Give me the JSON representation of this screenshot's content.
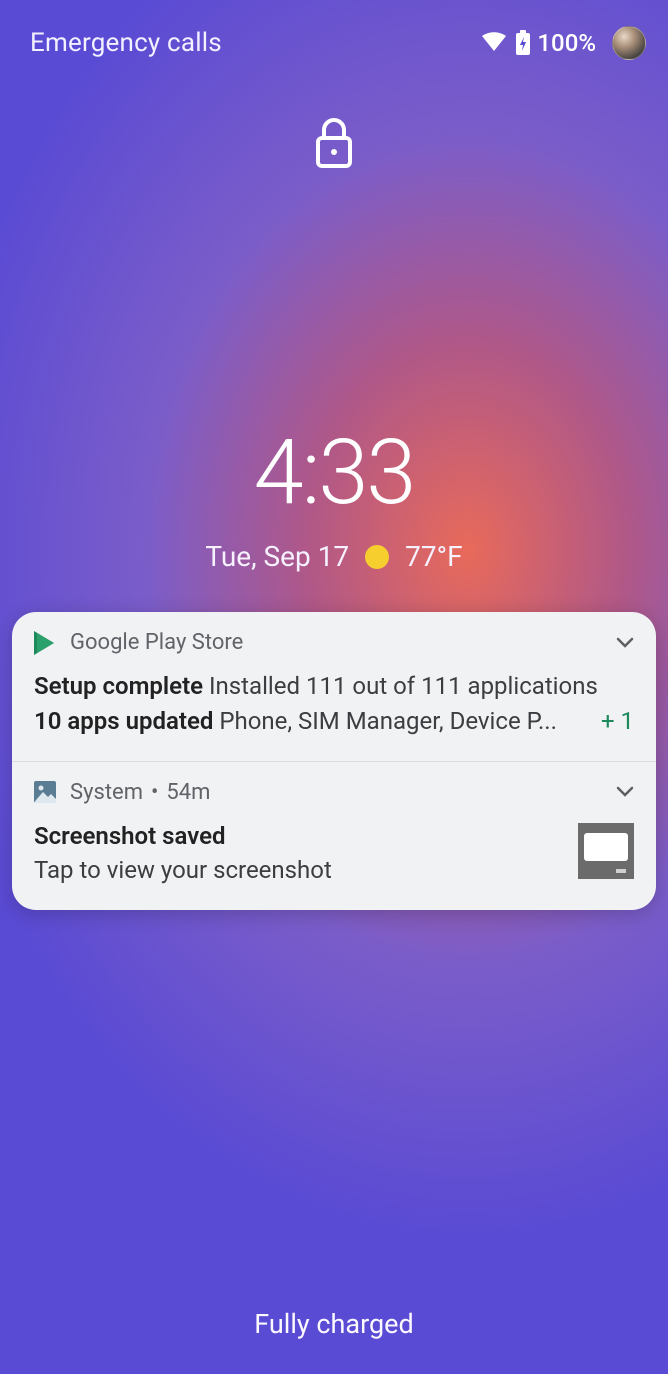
{
  "status": {
    "carrier_text": "Emergency calls",
    "battery_pct": "100%"
  },
  "clock": {
    "time": "4:33",
    "date": "Tue, Sep 17",
    "temp": "77°F"
  },
  "notifications": [
    {
      "app": "Google Play Store",
      "time": "",
      "line1_bold": "Setup complete",
      "line1_rest": " Installed 111 out of 111 applications",
      "line2_bold": "10 apps updated",
      "line2_rest": " Phone, SIM Manager, Device P...",
      "more": "+ 1",
      "icon": "play-store",
      "thumb": false
    },
    {
      "app": "System",
      "time": "54m",
      "line1_bold": "Screenshot saved",
      "line1_rest": "",
      "line2_bold": "",
      "line2_rest": "Tap to view your screenshot",
      "more": "",
      "icon": "system-image",
      "thumb": true
    }
  ],
  "footer": {
    "charge_text": "Fully charged"
  }
}
